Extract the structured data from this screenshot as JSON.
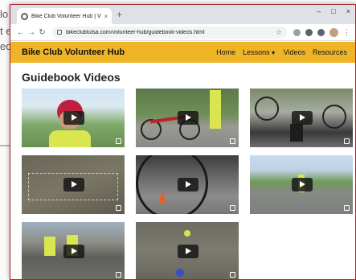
{
  "background_window": {
    "text_lines": [
      "lo",
      "t e",
      "eq"
    ]
  },
  "browser": {
    "tab_title": "Bike Club Volunteer Hub | Videos",
    "tab_close": "×",
    "new_tab": "+",
    "url": "bikeclubtulsa.com/volunteer-hub/guidebook-videos.html",
    "window_controls": {
      "minimize": "–",
      "maximize": "□",
      "close": "×"
    }
  },
  "site": {
    "brand": "Bike Club Volunteer Hub",
    "nav": [
      {
        "label": "Home"
      },
      {
        "label": "Lessons",
        "has_dropdown": true
      },
      {
        "label": "Videos"
      },
      {
        "label": "Resources"
      }
    ],
    "page_title": "Guidebook Videos"
  },
  "videos": [
    {
      "id": 1,
      "thumbnail": "helmeted-rider-closeup"
    },
    {
      "id": 2,
      "thumbnail": "red-bike-parked"
    },
    {
      "id": 3,
      "thumbnail": "rider-feet-on-pedals"
    },
    {
      "id": 4,
      "thumbnail": "course-layout-overhead"
    },
    {
      "id": 5,
      "thumbnail": "wheel-closeup-with-cones"
    },
    {
      "id": 6,
      "thumbnail": "rider-in-parking-lot"
    },
    {
      "id": 7,
      "thumbnail": "group-riding-on-street"
    },
    {
      "id": 8,
      "thumbnail": "overhead-cone-course"
    }
  ],
  "colors": {
    "navbar": "#f0b527",
    "window_border": "#a8232b"
  }
}
